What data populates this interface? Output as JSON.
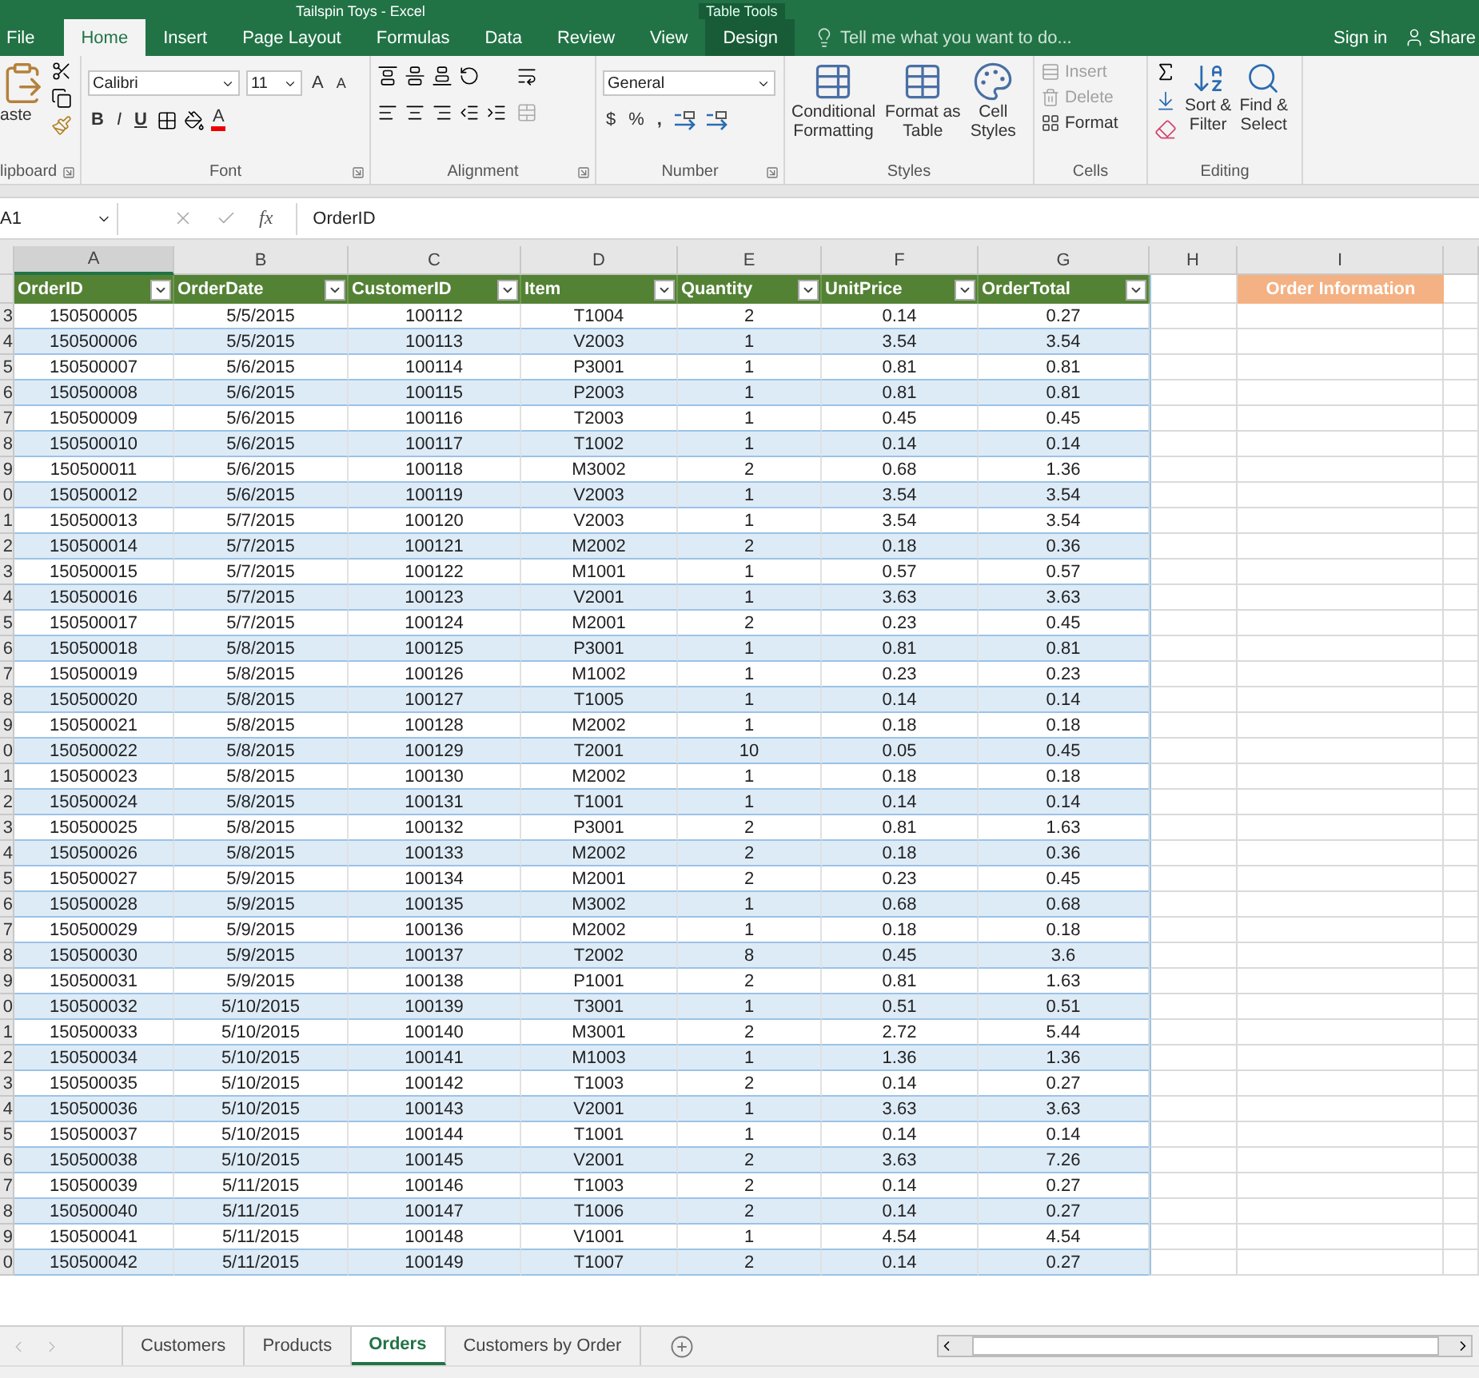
{
  "window": {
    "title": "Tailspin Toys - Excel",
    "context_title": "Table Tools"
  },
  "ribbon_tabs": [
    {
      "label": "File",
      "selected": false,
      "kind": "file"
    },
    {
      "label": "Home",
      "selected": true,
      "kind": "normal"
    },
    {
      "label": "Insert",
      "selected": false,
      "kind": "normal"
    },
    {
      "label": "Page Layout",
      "selected": false,
      "kind": "normal"
    },
    {
      "label": "Formulas",
      "selected": false,
      "kind": "normal"
    },
    {
      "label": "Data",
      "selected": false,
      "kind": "normal"
    },
    {
      "label": "Review",
      "selected": false,
      "kind": "normal"
    },
    {
      "label": "View",
      "selected": false,
      "kind": "normal"
    },
    {
      "label": "Design",
      "selected": false,
      "kind": "contextual"
    }
  ],
  "tell_me": {
    "placeholder": "Tell me what you want to do..."
  },
  "account": {
    "sign_in": "Sign in",
    "share": "Share"
  },
  "ribbon": {
    "clipboard": {
      "paste": "aste",
      "label": "lipboard"
    },
    "font": {
      "name": "Calibri",
      "size": "11",
      "grow": "A",
      "shrink": "A",
      "bold": "B",
      "italic": "I",
      "underline": "U",
      "font_color_glyph": "A",
      "label": "Font"
    },
    "alignment": {
      "label": "Alignment"
    },
    "number": {
      "format": "General",
      "currency": "$",
      "percent": "%",
      "comma": ",",
      "label": "Number"
    },
    "styles": {
      "buttons": [
        {
          "lines": [
            "Conditional",
            "Formatting"
          ]
        },
        {
          "lines": [
            "Format as",
            "Table"
          ]
        },
        {
          "lines": [
            "Cell",
            "Styles"
          ]
        }
      ],
      "label": "Styles"
    },
    "cells": {
      "items": [
        {
          "label": "Insert",
          "disabled": true
        },
        {
          "label": "Delete",
          "disabled": true
        },
        {
          "label": "Format",
          "disabled": false
        }
      ],
      "label": "Cells"
    },
    "editing": {
      "buttons": [
        {
          "lines": [
            "Sort &",
            "Filter"
          ]
        },
        {
          "lines": [
            "Find &",
            "Select"
          ]
        }
      ],
      "label": "Editing"
    }
  },
  "formula_bar": {
    "name_box": "A1",
    "fx": "fx",
    "formula": "OrderID"
  },
  "sheet": {
    "columns": [
      {
        "letter": "A",
        "selected": true
      },
      {
        "letter": "B",
        "selected": false
      },
      {
        "letter": "C",
        "selected": false
      },
      {
        "letter": "D",
        "selected": false
      },
      {
        "letter": "E",
        "selected": false
      },
      {
        "letter": "F",
        "selected": false
      },
      {
        "letter": "G",
        "selected": false
      },
      {
        "letter": "H",
        "selected": false
      },
      {
        "letter": "I",
        "selected": false
      }
    ],
    "table_headers": [
      "OrderID",
      "OrderDate",
      "CustomerID",
      "Item",
      "Quantity",
      "UnitPrice",
      "OrderTotal"
    ],
    "info_header": "Order Information",
    "rows": [
      {
        "n": "3",
        "cells": [
          "150500005",
          "5/5/2015",
          "100112",
          "T1004",
          "2",
          "0.14",
          "0.27"
        ]
      },
      {
        "n": "4",
        "cells": [
          "150500006",
          "5/5/2015",
          "100113",
          "V2003",
          "1",
          "3.54",
          "3.54"
        ]
      },
      {
        "n": "5",
        "cells": [
          "150500007",
          "5/6/2015",
          "100114",
          "P3001",
          "1",
          "0.81",
          "0.81"
        ]
      },
      {
        "n": "6",
        "cells": [
          "150500008",
          "5/6/2015",
          "100115",
          "P2003",
          "1",
          "0.81",
          "0.81"
        ]
      },
      {
        "n": "7",
        "cells": [
          "150500009",
          "5/6/2015",
          "100116",
          "T2003",
          "1",
          "0.45",
          "0.45"
        ]
      },
      {
        "n": "8",
        "cells": [
          "150500010",
          "5/6/2015",
          "100117",
          "T1002",
          "1",
          "0.14",
          "0.14"
        ]
      },
      {
        "n": "9",
        "cells": [
          "150500011",
          "5/6/2015",
          "100118",
          "M3002",
          "2",
          "0.68",
          "1.36"
        ]
      },
      {
        "n": "0",
        "cells": [
          "150500012",
          "5/6/2015",
          "100119",
          "V2003",
          "1",
          "3.54",
          "3.54"
        ]
      },
      {
        "n": "1",
        "cells": [
          "150500013",
          "5/7/2015",
          "100120",
          "V2003",
          "1",
          "3.54",
          "3.54"
        ]
      },
      {
        "n": "2",
        "cells": [
          "150500014",
          "5/7/2015",
          "100121",
          "M2002",
          "2",
          "0.18",
          "0.36"
        ]
      },
      {
        "n": "3",
        "cells": [
          "150500015",
          "5/7/2015",
          "100122",
          "M1001",
          "1",
          "0.57",
          "0.57"
        ]
      },
      {
        "n": "4",
        "cells": [
          "150500016",
          "5/7/2015",
          "100123",
          "V2001",
          "1",
          "3.63",
          "3.63"
        ]
      },
      {
        "n": "5",
        "cells": [
          "150500017",
          "5/7/2015",
          "100124",
          "M2001",
          "2",
          "0.23",
          "0.45"
        ]
      },
      {
        "n": "6",
        "cells": [
          "150500018",
          "5/8/2015",
          "100125",
          "P3001",
          "1",
          "0.81",
          "0.81"
        ]
      },
      {
        "n": "7",
        "cells": [
          "150500019",
          "5/8/2015",
          "100126",
          "M1002",
          "1",
          "0.23",
          "0.23"
        ]
      },
      {
        "n": "8",
        "cells": [
          "150500020",
          "5/8/2015",
          "100127",
          "T1005",
          "1",
          "0.14",
          "0.14"
        ]
      },
      {
        "n": "9",
        "cells": [
          "150500021",
          "5/8/2015",
          "100128",
          "M2002",
          "1",
          "0.18",
          "0.18"
        ]
      },
      {
        "n": "0",
        "cells": [
          "150500022",
          "5/8/2015",
          "100129",
          "T2001",
          "10",
          "0.05",
          "0.45"
        ]
      },
      {
        "n": "1",
        "cells": [
          "150500023",
          "5/8/2015",
          "100130",
          "M2002",
          "1",
          "0.18",
          "0.18"
        ]
      },
      {
        "n": "2",
        "cells": [
          "150500024",
          "5/8/2015",
          "100131",
          "T1001",
          "1",
          "0.14",
          "0.14"
        ]
      },
      {
        "n": "3",
        "cells": [
          "150500025",
          "5/8/2015",
          "100132",
          "P3001",
          "2",
          "0.81",
          "1.63"
        ]
      },
      {
        "n": "4",
        "cells": [
          "150500026",
          "5/8/2015",
          "100133",
          "M2002",
          "2",
          "0.18",
          "0.36"
        ]
      },
      {
        "n": "5",
        "cells": [
          "150500027",
          "5/9/2015",
          "100134",
          "M2001",
          "2",
          "0.23",
          "0.45"
        ]
      },
      {
        "n": "6",
        "cells": [
          "150500028",
          "5/9/2015",
          "100135",
          "M3002",
          "1",
          "0.68",
          "0.68"
        ]
      },
      {
        "n": "7",
        "cells": [
          "150500029",
          "5/9/2015",
          "100136",
          "M2002",
          "1",
          "0.18",
          "0.18"
        ]
      },
      {
        "n": "8",
        "cells": [
          "150500030",
          "5/9/2015",
          "100137",
          "T2002",
          "8",
          "0.45",
          "3.6"
        ]
      },
      {
        "n": "9",
        "cells": [
          "150500031",
          "5/9/2015",
          "100138",
          "P1001",
          "2",
          "0.81",
          "1.63"
        ]
      },
      {
        "n": "0",
        "cells": [
          "150500032",
          "5/10/2015",
          "100139",
          "T3001",
          "1",
          "0.51",
          "0.51"
        ]
      },
      {
        "n": "1",
        "cells": [
          "150500033",
          "5/10/2015",
          "100140",
          "M3001",
          "2",
          "2.72",
          "5.44"
        ]
      },
      {
        "n": "2",
        "cells": [
          "150500034",
          "5/10/2015",
          "100141",
          "M1003",
          "1",
          "1.36",
          "1.36"
        ]
      },
      {
        "n": "3",
        "cells": [
          "150500035",
          "5/10/2015",
          "100142",
          "T1003",
          "2",
          "0.14",
          "0.27"
        ]
      },
      {
        "n": "4",
        "cells": [
          "150500036",
          "5/10/2015",
          "100143",
          "V2001",
          "1",
          "3.63",
          "3.63"
        ]
      },
      {
        "n": "5",
        "cells": [
          "150500037",
          "5/10/2015",
          "100144",
          "T1001",
          "1",
          "0.14",
          "0.14"
        ]
      },
      {
        "n": "6",
        "cells": [
          "150500038",
          "5/10/2015",
          "100145",
          "V2001",
          "2",
          "3.63",
          "7.26"
        ]
      },
      {
        "n": "7",
        "cells": [
          "150500039",
          "5/11/2015",
          "100146",
          "T1003",
          "2",
          "0.14",
          "0.27"
        ]
      },
      {
        "n": "8",
        "cells": [
          "150500040",
          "5/11/2015",
          "100147",
          "T1006",
          "2",
          "0.14",
          "0.27"
        ]
      },
      {
        "n": "9",
        "cells": [
          "150500041",
          "5/11/2015",
          "100148",
          "V1001",
          "1",
          "4.54",
          "4.54"
        ]
      },
      {
        "n": "0",
        "cells": [
          "150500042",
          "5/11/2015",
          "100149",
          "T1007",
          "2",
          "0.14",
          "0.27"
        ]
      }
    ]
  },
  "sheet_tabs": [
    {
      "label": "Customers",
      "selected": false
    },
    {
      "label": "Products",
      "selected": false
    },
    {
      "label": "Orders",
      "selected": true
    },
    {
      "label": "Customers by Order",
      "selected": false
    }
  ]
}
